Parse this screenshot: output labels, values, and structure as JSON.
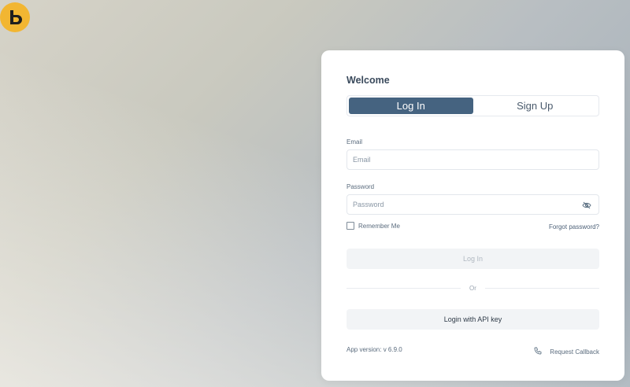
{
  "card": {
    "title": "Welcome",
    "tabs": [
      {
        "label": "Log In",
        "active": true
      },
      {
        "label": "Sign Up",
        "active": false
      }
    ],
    "email": {
      "label": "Email",
      "placeholder": "Email",
      "value": ""
    },
    "password": {
      "label": "Password",
      "placeholder": "Password",
      "value": "",
      "toggle_icon": "eye-off-icon"
    },
    "remember_me": {
      "label": "Remember Me",
      "checked": false
    },
    "forgot_password": "Forgot password?",
    "login_button": "Log In",
    "divider": "Or",
    "api_key_button": "Login with API key",
    "app_version": "App version: v 6.9.0",
    "request_callback": {
      "label": "Request Callback",
      "icon": "phone-icon"
    }
  },
  "logo": {
    "icon": "brand-logo-icon"
  },
  "colors": {
    "accent": "#456380",
    "logo": "#f2b632",
    "card_bg": "#ffffff"
  }
}
